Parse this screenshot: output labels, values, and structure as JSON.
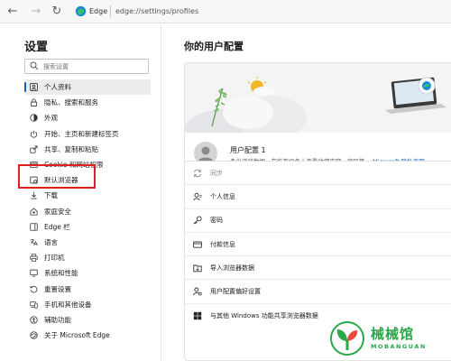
{
  "toolbar": {
    "browser_name": "Edge",
    "url": "edge://settings/profiles",
    "icons": [
      "back-icon",
      "forward-icon",
      "reload-icon",
      "edge-logo-icon"
    ]
  },
  "sidebar": {
    "title": "设置",
    "search_placeholder": "搜索设置",
    "items": [
      {
        "label": "个人资料",
        "icon": "person-icon",
        "active": true
      },
      {
        "label": "隐私、搜索和服务",
        "icon": "lock-icon"
      },
      {
        "label": "外观",
        "icon": "appearance-icon"
      },
      {
        "label": "开始、主页和新建标签页",
        "icon": "power-icon"
      },
      {
        "label": "共享、复制和粘贴",
        "icon": "share-icon"
      },
      {
        "label": "Cookie 和网站权限",
        "icon": "cookie-icon"
      },
      {
        "label": "默认浏览器",
        "icon": "browser-icon",
        "highlighted": true
      },
      {
        "label": "下载",
        "icon": "download-icon"
      },
      {
        "label": "家庭安全",
        "icon": "family-icon"
      },
      {
        "label": "Edge 栏",
        "icon": "edge-bar-icon"
      },
      {
        "label": "语言",
        "icon": "language-icon"
      },
      {
        "label": "打印机",
        "icon": "printer-icon"
      },
      {
        "label": "系统和性能",
        "icon": "system-icon"
      },
      {
        "label": "重置设置",
        "icon": "reset-icon"
      },
      {
        "label": "手机和其他设备",
        "icon": "phone-icon"
      },
      {
        "label": "辅助功能",
        "icon": "accessibility-icon"
      },
      {
        "label": "关于 Microsoft Edge",
        "icon": "edge-logo-icon"
      }
    ],
    "highlight_color": "#e01e1e"
  },
  "main": {
    "title": "你的用户配置",
    "profile": {
      "name": "用户配置 1",
      "description": "备份浏览数据，在所有设备上查看收藏内容，密码等。",
      "link": "Microsoft 隐私声明"
    },
    "list": [
      {
        "label": "同步",
        "icon": "sync-icon",
        "dim": true
      },
      {
        "label": "个人信息",
        "icon": "person-card-icon"
      },
      {
        "label": "密码",
        "icon": "key-icon"
      },
      {
        "label": "付款信息",
        "icon": "card-icon"
      },
      {
        "label": "导入浏览器数据",
        "icon": "import-icon"
      },
      {
        "label": "用户配置偏好设置",
        "icon": "profile-settings-icon"
      },
      {
        "label": "与其他 Windows 功能共享浏览器数据",
        "icon": "windows-icon"
      }
    ]
  },
  "watermark": {
    "text": "械械馆",
    "sub": "MOBANGUAN",
    "color": "#27a64a"
  },
  "accent_color": "#0067c0"
}
